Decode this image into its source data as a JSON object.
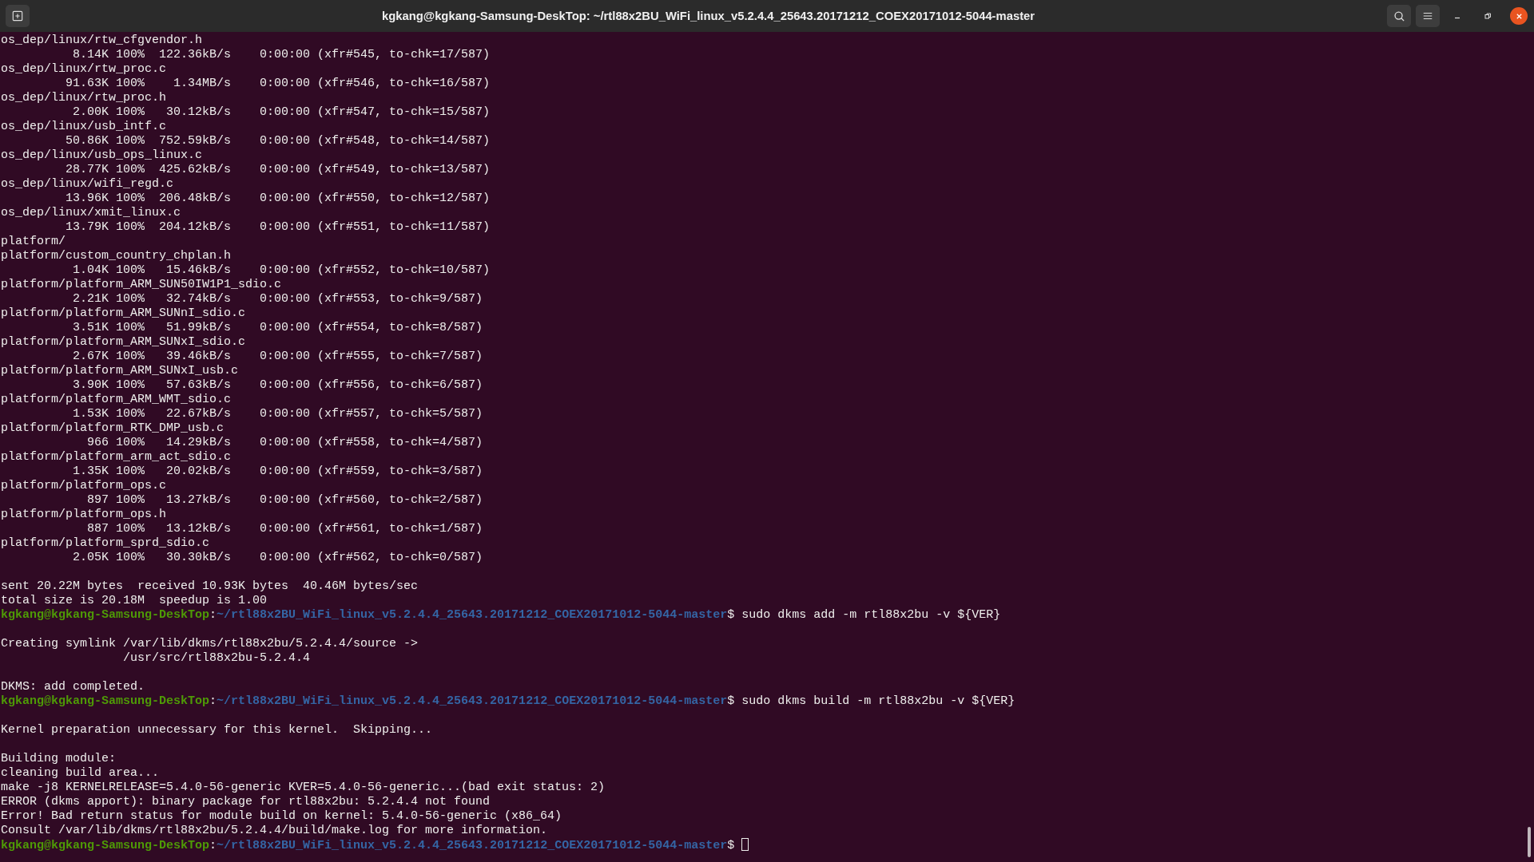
{
  "window": {
    "title": "kgkang@kgkang-Samsung-DeskTop: ~/rtl88x2BU_WiFi_linux_v5.2.4.4_25643.20171212_COEX20171012-5044-master"
  },
  "terminal": {
    "lines": [
      {
        "kind": "output",
        "text": "os_dep/linux/rtw_cfgvendor.h"
      },
      {
        "kind": "output",
        "text": "          8.14K 100%  122.36kB/s    0:00:00 (xfr#545, to-chk=17/587)"
      },
      {
        "kind": "output",
        "text": "os_dep/linux/rtw_proc.c"
      },
      {
        "kind": "output",
        "text": "         91.63K 100%    1.34MB/s    0:00:00 (xfr#546, to-chk=16/587)"
      },
      {
        "kind": "output",
        "text": "os_dep/linux/rtw_proc.h"
      },
      {
        "kind": "output",
        "text": "          2.00K 100%   30.12kB/s    0:00:00 (xfr#547, to-chk=15/587)"
      },
      {
        "kind": "output",
        "text": "os_dep/linux/usb_intf.c"
      },
      {
        "kind": "output",
        "text": "         50.86K 100%  752.59kB/s    0:00:00 (xfr#548, to-chk=14/587)"
      },
      {
        "kind": "output",
        "text": "os_dep/linux/usb_ops_linux.c"
      },
      {
        "kind": "output",
        "text": "         28.77K 100%  425.62kB/s    0:00:00 (xfr#549, to-chk=13/587)"
      },
      {
        "kind": "output",
        "text": "os_dep/linux/wifi_regd.c"
      },
      {
        "kind": "output",
        "text": "         13.96K 100%  206.48kB/s    0:00:00 (xfr#550, to-chk=12/587)"
      },
      {
        "kind": "output",
        "text": "os_dep/linux/xmit_linux.c"
      },
      {
        "kind": "output",
        "text": "         13.79K 100%  204.12kB/s    0:00:00 (xfr#551, to-chk=11/587)"
      },
      {
        "kind": "output",
        "text": "platform/"
      },
      {
        "kind": "output",
        "text": "platform/custom_country_chplan.h"
      },
      {
        "kind": "output",
        "text": "          1.04K 100%   15.46kB/s    0:00:00 (xfr#552, to-chk=10/587)"
      },
      {
        "kind": "output",
        "text": "platform/platform_ARM_SUN50IW1P1_sdio.c"
      },
      {
        "kind": "output",
        "text": "          2.21K 100%   32.74kB/s    0:00:00 (xfr#553, to-chk=9/587)"
      },
      {
        "kind": "output",
        "text": "platform/platform_ARM_SUNnI_sdio.c"
      },
      {
        "kind": "output",
        "text": "          3.51K 100%   51.99kB/s    0:00:00 (xfr#554, to-chk=8/587)"
      },
      {
        "kind": "output",
        "text": "platform/platform_ARM_SUNxI_sdio.c"
      },
      {
        "kind": "output",
        "text": "          2.67K 100%   39.46kB/s    0:00:00 (xfr#555, to-chk=7/587)"
      },
      {
        "kind": "output",
        "text": "platform/platform_ARM_SUNxI_usb.c"
      },
      {
        "kind": "output",
        "text": "          3.90K 100%   57.63kB/s    0:00:00 (xfr#556, to-chk=6/587)"
      },
      {
        "kind": "output",
        "text": "platform/platform_ARM_WMT_sdio.c"
      },
      {
        "kind": "output",
        "text": "          1.53K 100%   22.67kB/s    0:00:00 (xfr#557, to-chk=5/587)"
      },
      {
        "kind": "output",
        "text": "platform/platform_RTK_DMP_usb.c"
      },
      {
        "kind": "output",
        "text": "            966 100%   14.29kB/s    0:00:00 (xfr#558, to-chk=4/587)"
      },
      {
        "kind": "output",
        "text": "platform/platform_arm_act_sdio.c"
      },
      {
        "kind": "output",
        "text": "          1.35K 100%   20.02kB/s    0:00:00 (xfr#559, to-chk=3/587)"
      },
      {
        "kind": "output",
        "text": "platform/platform_ops.c"
      },
      {
        "kind": "output",
        "text": "            897 100%   13.27kB/s    0:00:00 (xfr#560, to-chk=2/587)"
      },
      {
        "kind": "output",
        "text": "platform/platform_ops.h"
      },
      {
        "kind": "output",
        "text": "            887 100%   13.12kB/s    0:00:00 (xfr#561, to-chk=1/587)"
      },
      {
        "kind": "output",
        "text": "platform/platform_sprd_sdio.c"
      },
      {
        "kind": "output",
        "text": "          2.05K 100%   30.30kB/s    0:00:00 (xfr#562, to-chk=0/587)"
      },
      {
        "kind": "blank"
      },
      {
        "kind": "output",
        "text": "sent 20.22M bytes  received 10.93K bytes  40.46M bytes/sec"
      },
      {
        "kind": "output",
        "text": "total size is 20.18M  speedup is 1.00"
      },
      {
        "kind": "prompt",
        "user_host": "kgkang@kgkang-Samsung-DeskTop",
        "separator": ":",
        "path": "~/rtl88x2BU_WiFi_linux_v5.2.4.4_25643.20171212_COEX20171012-5044-master",
        "symbol": "$",
        "command": "sudo dkms add -m rtl88x2bu -v ${VER}",
        "cursor": false
      },
      {
        "kind": "blank"
      },
      {
        "kind": "output",
        "text": "Creating symlink /var/lib/dkms/rtl88x2bu/5.2.4.4/source ->"
      },
      {
        "kind": "output",
        "text": "                 /usr/src/rtl88x2bu-5.2.4.4"
      },
      {
        "kind": "blank"
      },
      {
        "kind": "output",
        "text": "DKMS: add completed."
      },
      {
        "kind": "prompt",
        "user_host": "kgkang@kgkang-Samsung-DeskTop",
        "separator": ":",
        "path": "~/rtl88x2BU_WiFi_linux_v5.2.4.4_25643.20171212_COEX20171012-5044-master",
        "symbol": "$",
        "command": "sudo dkms build -m rtl88x2bu -v ${VER}",
        "cursor": false
      },
      {
        "kind": "blank"
      },
      {
        "kind": "output",
        "text": "Kernel preparation unnecessary for this kernel.  Skipping..."
      },
      {
        "kind": "blank"
      },
      {
        "kind": "output",
        "text": "Building module:"
      },
      {
        "kind": "output",
        "text": "cleaning build area..."
      },
      {
        "kind": "output",
        "text": "make -j8 KERNELRELEASE=5.4.0-56-generic KVER=5.4.0-56-generic...(bad exit status: 2)"
      },
      {
        "kind": "output",
        "text": "ERROR (dkms apport): binary package for rtl88x2bu: 5.2.4.4 not found"
      },
      {
        "kind": "output",
        "text": "Error! Bad return status for module build on kernel: 5.4.0-56-generic (x86_64)"
      },
      {
        "kind": "output",
        "text": "Consult /var/lib/dkms/rtl88x2bu/5.2.4.4/build/make.log for more information."
      },
      {
        "kind": "prompt",
        "user_host": "kgkang@kgkang-Samsung-DeskTop",
        "separator": ":",
        "path": "~/rtl88x2BU_WiFi_linux_v5.2.4.4_25643.20171212_COEX20171012-5044-master",
        "symbol": "$",
        "cursor": true
      }
    ]
  }
}
